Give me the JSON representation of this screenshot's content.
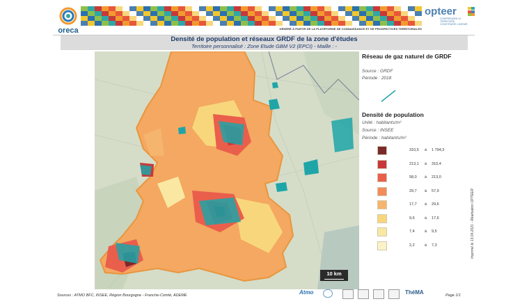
{
  "header": {
    "oreca_logo": "oreca",
    "generated_note": "GÉNÉRÉ À PARTIR DE LA PLATEFORME DE CONNAISSANCE ET DE PROSPECTIVES TERRITORIALES",
    "opteer_logo": "opteer",
    "opteer_tagline": "COMPRENDRE LE TERRITOIRE, CONSTRUIRE L'AVENIR"
  },
  "title": {
    "main": "Densité de population et réseaux GRDF de la zone d'études",
    "sub": "Territoire personnalisé : Zone Etude GBM V2 (EPCI) - Maille : -"
  },
  "map": {
    "scale_label": "10 km"
  },
  "legend": {
    "gas_title": "Réseau de gaz naturel de GRDF",
    "gas_source": "Source : GRDF",
    "gas_period": "Période : 2018",
    "gas_color": "#1fa5a8",
    "density_title": "Densité de population",
    "density_unit": "Unité : habitants/m²",
    "density_source": "Source : INSEE",
    "density_period": "Période : habitants/m²",
    "classes": [
      {
        "low": "310,5",
        "sep": "à",
        "high": "1 794,3",
        "color": "#7a2a2a"
      },
      {
        "low": "213,1",
        "sep": "à",
        "high": "310,4",
        "color": "#c8383a"
      },
      {
        "low": "58,0",
        "sep": "à",
        "high": "213,0",
        "color": "#ea5e4c"
      },
      {
        "low": "29,7",
        "sep": "à",
        "high": "57,9",
        "color": "#f28c5a"
      },
      {
        "low": "17,7",
        "sep": "à",
        "high": "29,6",
        "color": "#f6b56e"
      },
      {
        "low": "9,6",
        "sep": "à",
        "high": "17,6",
        "color": "#f8d77c"
      },
      {
        "low": "7,4",
        "sep": "à",
        "high": "9,5",
        "color": "#fae8a2"
      },
      {
        "low": "2,2",
        "sep": "à",
        "high": "7,3",
        "color": "#fcf2c8"
      }
    ]
  },
  "side_note": "Imprimé le 13.04.2021 - Réalisation OPTEER",
  "footer": {
    "sources": "Sources : ATMO BFC, INSEE, Région Bourgogne - Franche-Comté, ADEME",
    "page": "Page 1/1",
    "partner_atmo": "Atmo",
    "partner_thema": "ThéMA"
  }
}
